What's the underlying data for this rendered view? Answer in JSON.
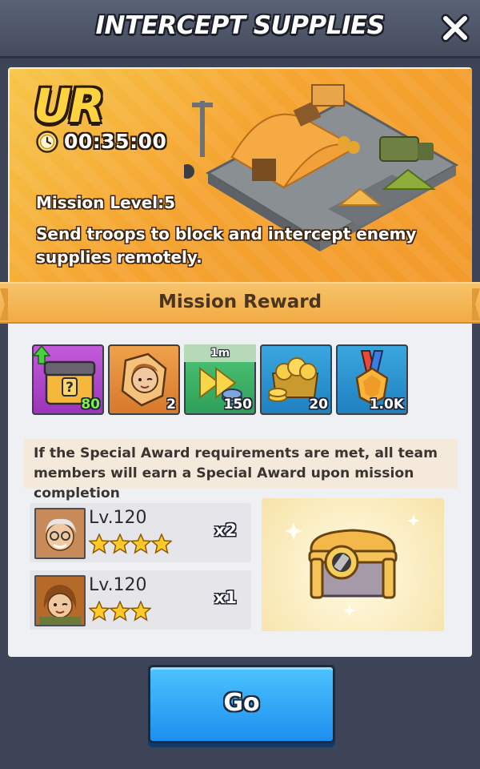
{
  "header": {
    "title": "INTERCEPT SUPPLIES",
    "close_icon": "close-icon"
  },
  "mission": {
    "rarity": "UR",
    "timer": "00:35:00",
    "level_text": "Mission Level:5",
    "description": "Send troops to block and intercept enemy supplies remotely."
  },
  "rewards": {
    "title": "Mission Reward",
    "items": [
      {
        "icon": "mystery-crate-icon",
        "quantity": "80",
        "quantity_color": "#7bf04a",
        "upgrade_arrow": true
      },
      {
        "icon": "hero-shard-icon",
        "quantity": "2"
      },
      {
        "icon": "speedup-icon",
        "label": "1m",
        "quantity": "150"
      },
      {
        "icon": "gold-coins-icon",
        "quantity": "20"
      },
      {
        "icon": "medal-icon",
        "quantity": "1.0K"
      }
    ]
  },
  "special_award": {
    "note": "If the Special Award requirements are met, all team members will earn a Special Award upon mission completion",
    "heroes": [
      {
        "level": "Lv.120",
        "stars": 4,
        "count": "x2"
      },
      {
        "level": "Lv.120",
        "stars": 3,
        "count": "x1"
      }
    ],
    "chest_icon": "special-chest-icon"
  },
  "go_button": {
    "label": "Go"
  },
  "colors": {
    "accent": "#f2ab45",
    "go_button": "#1d8ff0",
    "background": "#3d4458"
  }
}
